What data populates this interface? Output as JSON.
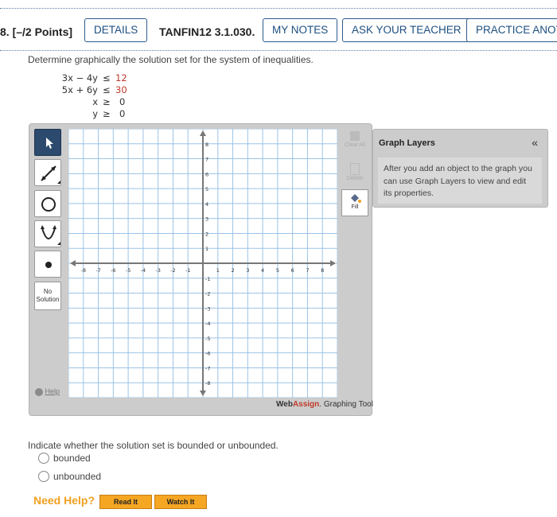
{
  "header": {
    "question_number": "8.",
    "points": "[–/2 Points]",
    "details_label": "DETAILS",
    "problem_code": "TANFIN12 3.1.030.",
    "my_notes_label": "MY NOTES",
    "ask_teacher_label": "ASK YOUR TEACHER",
    "practice_label": "PRACTICE ANOTHER"
  },
  "question": {
    "prompt": "Determine graphically the solution set for the system of inequalities.",
    "inequalities": [
      {
        "lhs": "3x − 4y",
        "op": "≤",
        "rhs": "12",
        "rhs_red": true
      },
      {
        "lhs": "5x + 6y",
        "op": "≤",
        "rhs": "30",
        "rhs_red": true
      },
      {
        "lhs": "x",
        "op": "≥",
        "rhs": "0",
        "rhs_red": false
      },
      {
        "lhs": "y",
        "op": "≥",
        "rhs": "0",
        "rhs_red": false
      }
    ]
  },
  "graph_tool": {
    "tools": [
      "pointer-tool",
      "line-tool",
      "circle-tool",
      "parabola-tool",
      "point-tool"
    ],
    "no_solution_label": [
      "No",
      "Solution"
    ],
    "help_label": "Help",
    "clear_all_label": "Clear All",
    "delete_label": "Delete",
    "fill_label": "Fill",
    "x_ticks": [
      "-8",
      "-7",
      "-6",
      "-5",
      "-4",
      "-3",
      "-2",
      "-1",
      "1",
      "2",
      "3",
      "4",
      "5",
      "6",
      "7",
      "8"
    ],
    "y_ticks": [
      "8",
      "7",
      "6",
      "5",
      "4",
      "3",
      "2",
      "1",
      "-1",
      "-2",
      "-3",
      "-4",
      "-5",
      "-6",
      "-7",
      "-8"
    ],
    "brand_web": "Web",
    "brand_assign": "Assign",
    "brand_suffix": ". Graphing Tool",
    "brand_accent": "#c0392b"
  },
  "graph_layers": {
    "title": "Graph Layers",
    "collapse_glyph": "«",
    "text": "After you add an object to the graph you can use Graph Layers to view and edit its properties."
  },
  "bounded_question": {
    "prompt": "Indicate whether the solution set is bounded or unbounded.",
    "options": [
      "bounded",
      "unbounded"
    ]
  },
  "need_help": {
    "label": "Need Help?",
    "read_it": "Read It",
    "watch_it": "Watch It",
    "color": "#f5a623"
  }
}
